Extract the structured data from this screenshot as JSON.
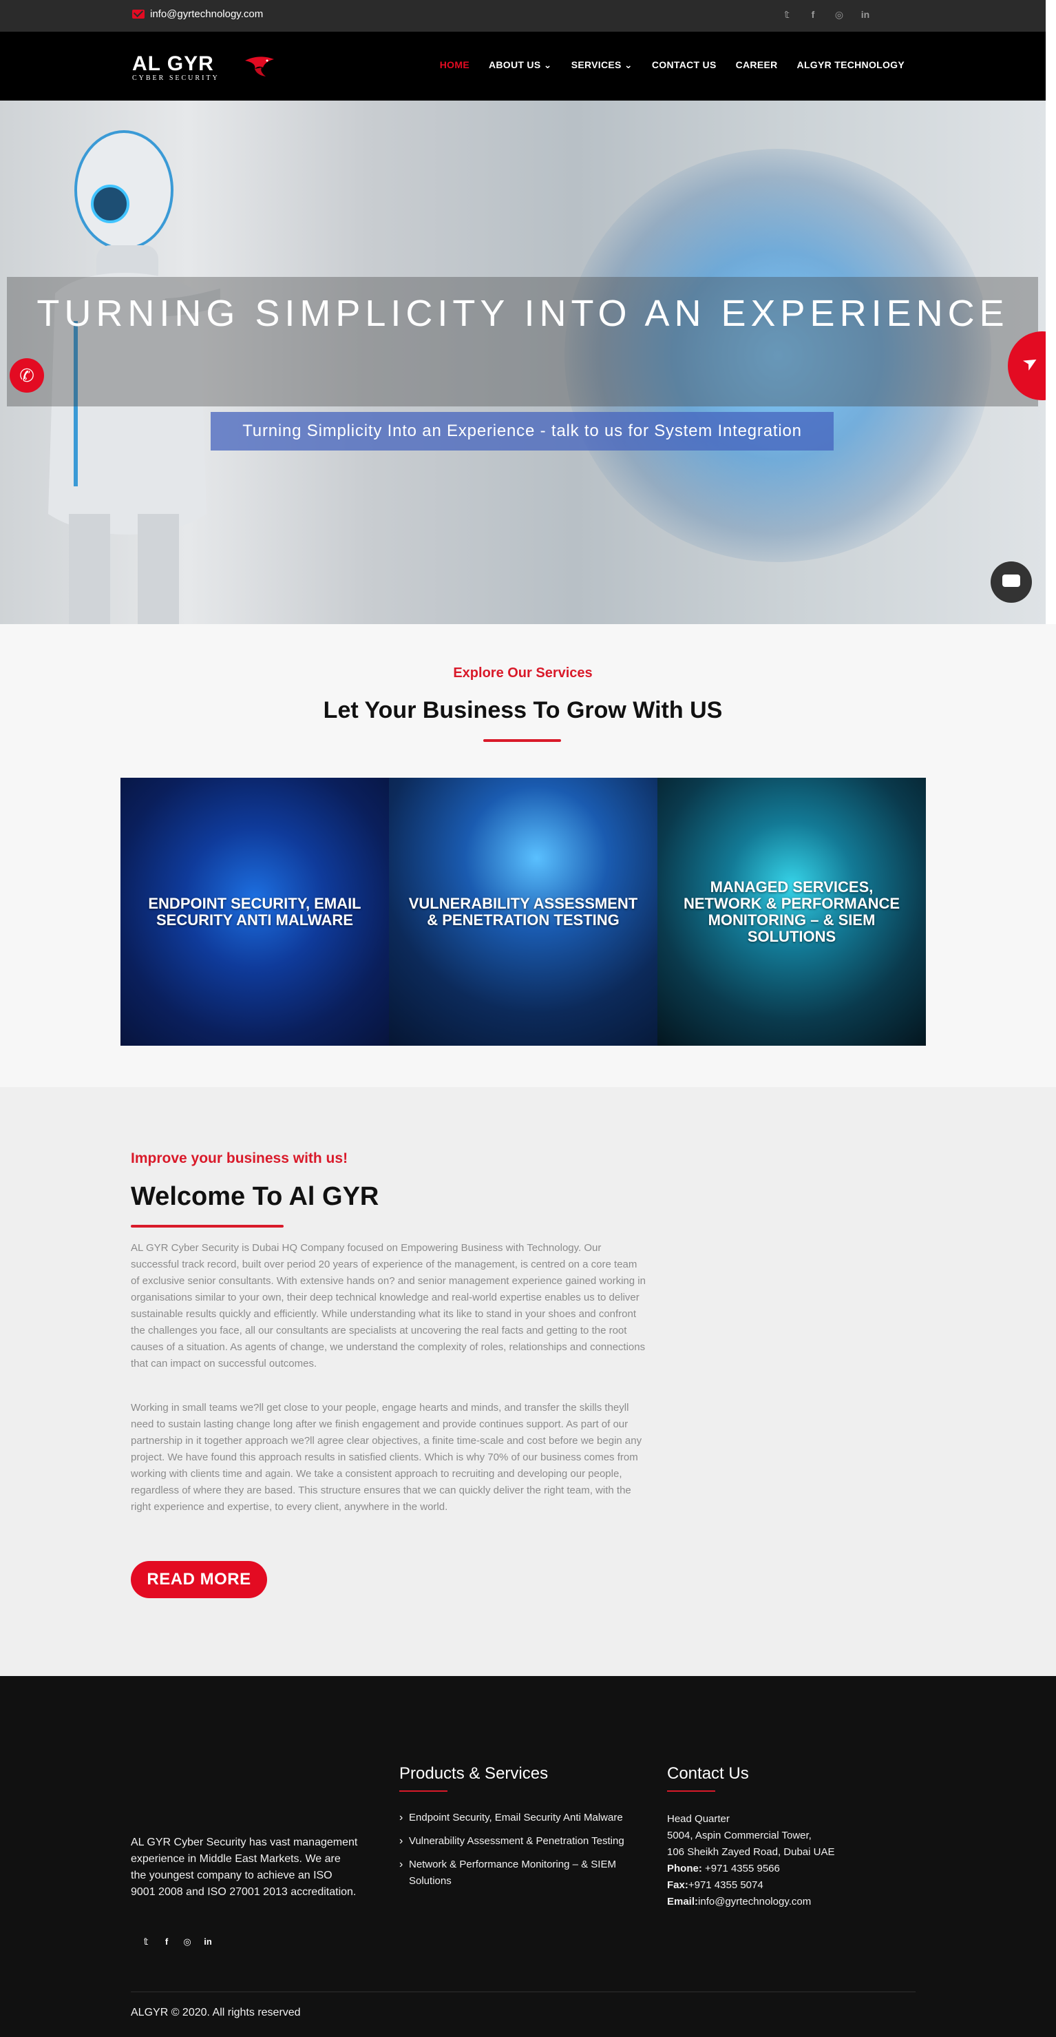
{
  "topbar": {
    "email": "info@gyrtechnology.com",
    "socials": [
      "twitter-icon",
      "facebook-icon",
      "instagram-icon",
      "linkedin-icon"
    ],
    "social_glyphs": [
      "𝕥",
      "f",
      "◎",
      "in"
    ]
  },
  "header": {
    "logo_main": "AL GYR",
    "logo_sub": "CYBER SECURITY",
    "nav": [
      {
        "label": "HOME",
        "active": true
      },
      {
        "label": "ABOUT US ⌄",
        "active": false
      },
      {
        "label": "SERVICES ⌄",
        "active": false
      },
      {
        "label": "CONTACT US",
        "active": false
      },
      {
        "label": "CAREER",
        "active": false
      },
      {
        "label": "ALGYR TECHNOLOGY",
        "active": false
      }
    ]
  },
  "hero": {
    "heading": "TURNING SIMPLICITY INTO AN EXPERIENCE",
    "subcaption": "Turning Simplicity Into an Experience - talk to us for System Integration",
    "prev": "‹",
    "next": "›"
  },
  "services": {
    "kicker": "Explore Our Services",
    "title": "Let Your Business To Grow With US",
    "cards": [
      "ENDPOINT SECURITY, EMAIL SECURITY ANTI MALWARE",
      "VULNERABILITY ASSESSMENT & PENETRATION TESTING",
      "MANAGED SERVICES, NETWORK & PERFORMANCE MONITORING – & SIEM SOLUTIONS"
    ]
  },
  "about": {
    "kicker": "Improve your business with us!",
    "title": "Welcome To Al GYR",
    "p1": "AL GYR Cyber Security is Dubai HQ Company focused on Empowering Business with Technology. Our successful track record, built over period 20 years of experience of the management, is centred on a core team of exclusive senior consultants. With extensive hands on? and senior management experience gained working in organisations similar to your own, their deep technical knowledge and real-world expertise enables us to deliver sustainable results quickly and efficiently. While understanding what its like to stand in your shoes and confront the challenges you face, all our consultants are specialists at uncovering the real facts and getting to the root causes of a situation. As agents of change, we understand the complexity of roles, relationships and connections that can impact on successful outcomes.",
    "p2": "Working in small teams we?ll get close to your people, engage hearts and minds, and transfer the skills theyll need to sustain lasting change long after we finish engagement and provide continues support. As part of our partnership in it together approach we?ll agree clear objectives, a finite time-scale and cost before we begin any project. We have found this approach results in satisfied clients. Which is why 70% of our business comes from working with clients time and again. We take a consistent approach to recruiting and developing our people, regardless of where they are based. This structure ensures that we can quickly deliver the right team, with the right experience and expertise, to every client, anywhere in the world.",
    "button": "READ MORE"
  },
  "footer": {
    "about": "AL GYR Cyber Security has vast management experience in Middle East Markets. We are the youngest company to achieve an ISO 9001 2008 and ISO 27001 2013 accreditation.",
    "products_title": "Products & Services",
    "products": [
      "Endpoint Security, Email Security Anti Malware",
      "Vulnerability Assessment & Penetration Testing",
      "Network & Performance Monitoring – & SIEM Solutions"
    ],
    "contact_title": "Contact Us",
    "contact": {
      "hq": "Head Quarter",
      "addr1": "5004, Aspin Commercial Tower,",
      "addr2": "106 Sheikh Zayed Road, Dubai UAE",
      "phone_label": "Phone:",
      "phone": " +971 4355 9566",
      "fax_label": "Fax:",
      "fax": "+971 4355 5074",
      "email_label": "Email:",
      "email": "info@gyrtechnology.com"
    },
    "copyright": "ALGYR © 2020. All rights reserved"
  },
  "colors": {
    "accent": "#e30b22",
    "header_bg": "#000000",
    "footer_bg": "#111111"
  }
}
